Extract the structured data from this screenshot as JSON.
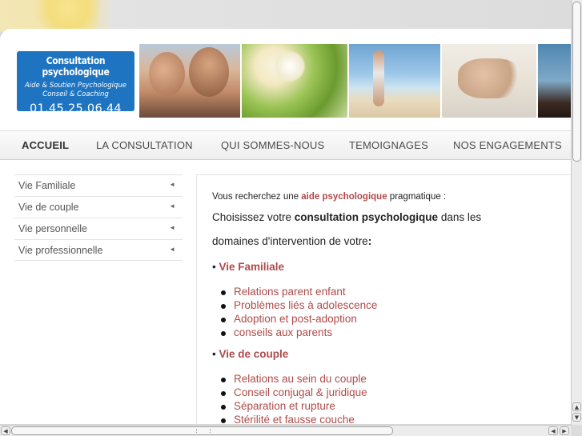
{
  "header": {
    "logo_title": "Consultation psychologique",
    "logo_line1": "Aide & Soutien Psychologique",
    "logo_line2": "Conseil & Coaching",
    "logo_phone": "01.45.25.06.44"
  },
  "nav": {
    "items": [
      {
        "label": "ACCUEIL"
      },
      {
        "label": "LA CONSULTATION"
      },
      {
        "label": "QUI SOMMES-NOUS"
      },
      {
        "label": "TEMOIGNAGES"
      },
      {
        "label": "NOS ENGAGEMENTS"
      }
    ]
  },
  "sidebar": {
    "items": [
      {
        "label": "Vie Familiale"
      },
      {
        "label": "Vie de couple"
      },
      {
        "label": "Vie personnelle"
      },
      {
        "label": "Vie professionnelle"
      }
    ],
    "arrow": "◄"
  },
  "content": {
    "intro_prefix": "Vous recherchez une ",
    "intro_highlight": "aide psychologique",
    "intro_suffix": " pragmatique :",
    "line2_prefix": "Choisissez votre ",
    "line2_bold": "consultation psychologique",
    "line2_suffix": " dans les",
    "line3_text": "domaines d'intervention  de votre",
    "line3_colon": ":",
    "bullet_marker": "• ",
    "section1": {
      "title": "Vie Familiale",
      "items": [
        "Relations parent enfant",
        "Problèmes liés à adolescence",
        "Adoption et  post-adoption",
        "conseils aux parents"
      ]
    },
    "section2": {
      "title": "Vie de couple",
      "items": [
        "Relations au sein du couple",
        "Conseil conjugal & juridique",
        "Séparation et rupture",
        "Stérilité et fausse couche"
      ]
    }
  },
  "colors": {
    "accent": "#b04a4a",
    "logo_bg": "#1e74c0"
  }
}
